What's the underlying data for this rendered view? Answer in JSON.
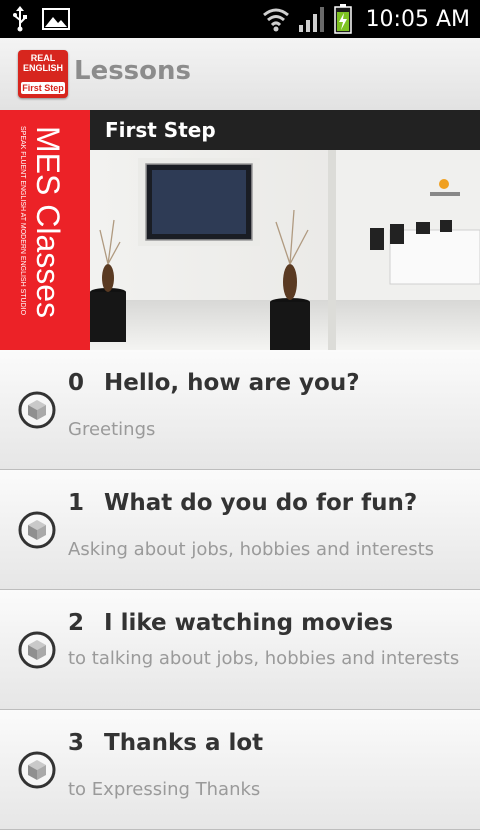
{
  "status_bar": {
    "time": "10:05 AM",
    "icons": [
      "usb-icon",
      "image-icon",
      "wifi-icon",
      "signal-icon",
      "battery-charging-icon"
    ]
  },
  "app_bar": {
    "title": "Lessons",
    "logo_lines": [
      "REAL",
      "ENGLISH",
      "First Step"
    ]
  },
  "banner": {
    "title": "First Step",
    "brand": "MES Classes",
    "tagline": "SPEAK FLUENT ENGLISH AT MODERN ENGLISH STUDIO"
  },
  "lessons": [
    {
      "number": "0",
      "title": "Hello, how are you?",
      "subtitle": "Greetings"
    },
    {
      "number": "1",
      "title": "What do you do for fun?",
      "subtitle": "Asking about jobs, hobbies and interests"
    },
    {
      "number": "2",
      "title": "I like watching movies",
      "subtitle": "to talking about jobs, hobbies and interests"
    },
    {
      "number": "3",
      "title": "Thanks a lot",
      "subtitle": "to Expressing Thanks"
    }
  ],
  "colors": {
    "accent_red": "#ec2227",
    "title_bar": "#222222",
    "subtitle_gray": "#9a9a9a"
  }
}
